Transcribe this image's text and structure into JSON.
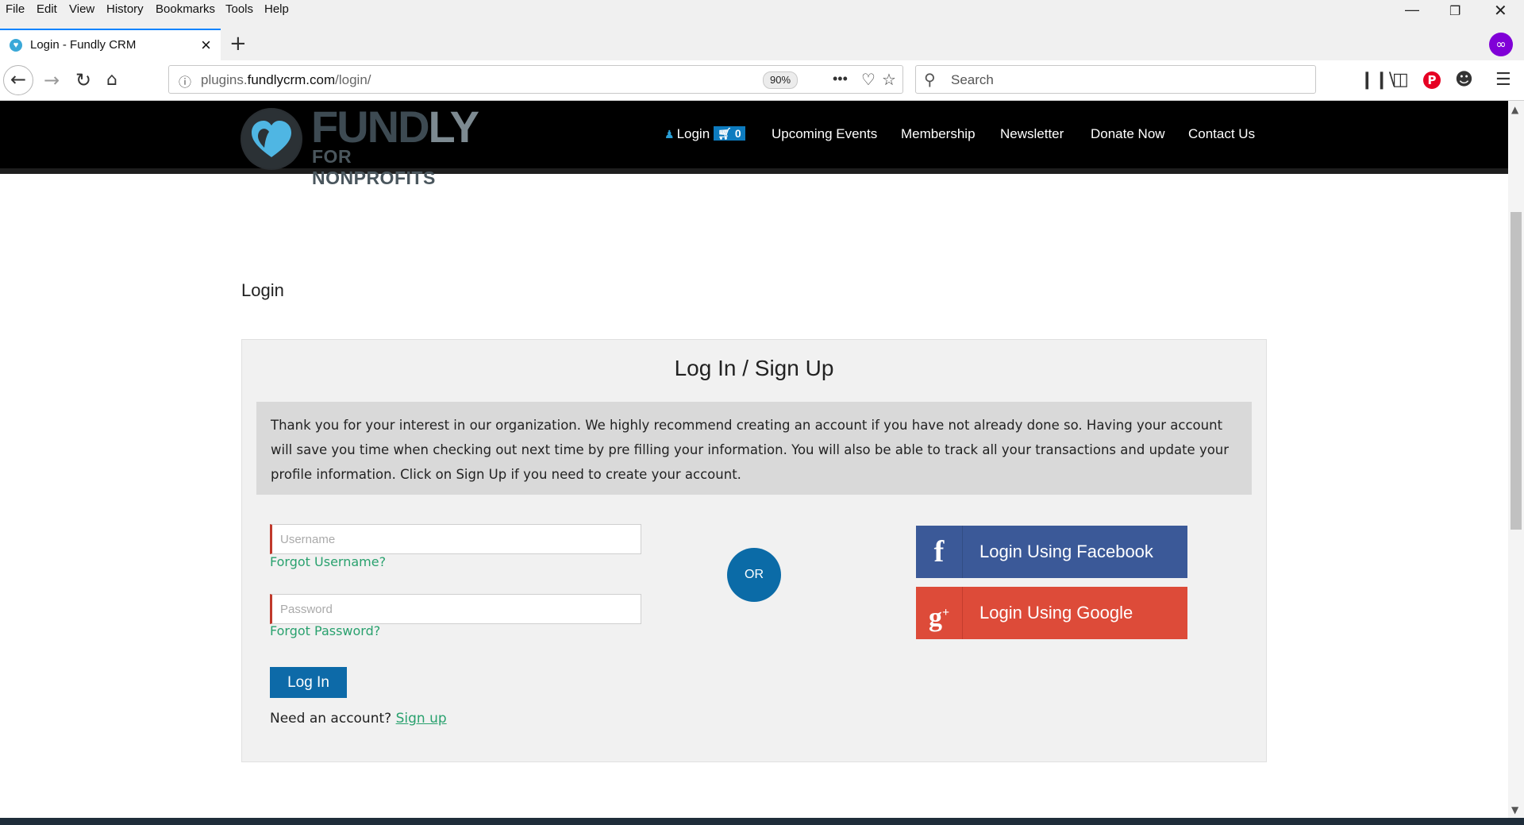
{
  "browser": {
    "menu": [
      "File",
      "Edit",
      "View",
      "History",
      "Bookmarks",
      "Tools",
      "Help"
    ],
    "tab_title": "Login - Fundly CRM",
    "url_prefix": "plugins.",
    "url_domain": "fundlycrm.com",
    "url_path": "/login/",
    "zoom": "90%",
    "search_placeholder": "Search"
  },
  "site": {
    "logo_word_a": "FUND",
    "logo_word_b": "LY",
    "logo_sub": "FOR NONPROFITS",
    "nav": {
      "login": "Login",
      "cart_count": "0",
      "events": "Upcoming Events",
      "membership": "Membership",
      "newsletter": "Newsletter",
      "donate": "Donate Now",
      "contact": "Contact Us"
    }
  },
  "page": {
    "title": "Login",
    "panel_heading": "Log In / Sign Up",
    "notice": "Thank you for your interest in our organization. We highly recommend creating an account if you have not already done so. Having your account will save you time when checking out next time by pre filling your information. You will also be able to track all your transactions and update your profile information. Click on Sign Up if you need to create your account.",
    "username_placeholder": "Username",
    "forgot_username": "Forgot Username?",
    "password_placeholder": "Password",
    "forgot_password": "Forgot Password?",
    "login_button": "Log In",
    "need_account": "Need an account?",
    "signup": "Sign up",
    "or": "OR",
    "facebook_button": "Login Using Facebook",
    "google_button": "Login Using Google"
  },
  "colors": {
    "accent_blue": "#0d6aa8",
    "link_green": "#29a16e",
    "facebook": "#3b5998",
    "google": "#dd4b39"
  }
}
